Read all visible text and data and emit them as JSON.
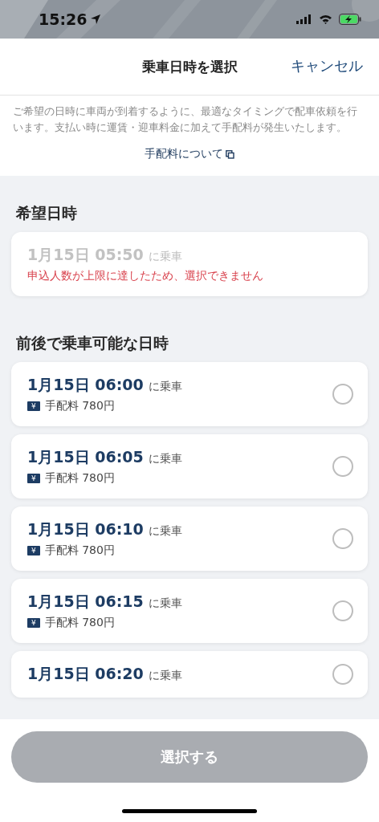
{
  "status_bar": {
    "time": "15:26"
  },
  "header": {
    "title": "乗車日時を選択",
    "cancel": "キャンセル"
  },
  "intro": {
    "text": "ご希望の日時に車両が到着するように、最適なタイミングで配車依頼を行います。支払い時に運賃・迎車料金に加えて手配料が発生いたします。",
    "link": "手配料について"
  },
  "preferred": {
    "heading": "希望日時",
    "slot": {
      "datetime": "1月15日 05:50",
      "suffix": "に乗車",
      "disabled": true,
      "error": "申込人数が上限に達したため、選択できません"
    }
  },
  "alternatives": {
    "heading": "前後で乗車可能な日時",
    "slots": [
      {
        "datetime": "1月15日 06:00",
        "suffix": "に乗車",
        "badge": "¥",
        "fee": "手配料 780円",
        "selected": false
      },
      {
        "datetime": "1月15日 06:05",
        "suffix": "に乗車",
        "badge": "¥",
        "fee": "手配料 780円",
        "selected": false
      },
      {
        "datetime": "1月15日 06:10",
        "suffix": "に乗車",
        "badge": "¥",
        "fee": "手配料 780円",
        "selected": false
      },
      {
        "datetime": "1月15日 06:15",
        "suffix": "に乗車",
        "badge": "¥",
        "fee": "手配料 780円",
        "selected": false
      },
      {
        "datetime": "1月15日 06:20",
        "suffix": "に乗車",
        "selected": false
      }
    ]
  },
  "footer": {
    "button": "選択する",
    "disabled": true
  }
}
